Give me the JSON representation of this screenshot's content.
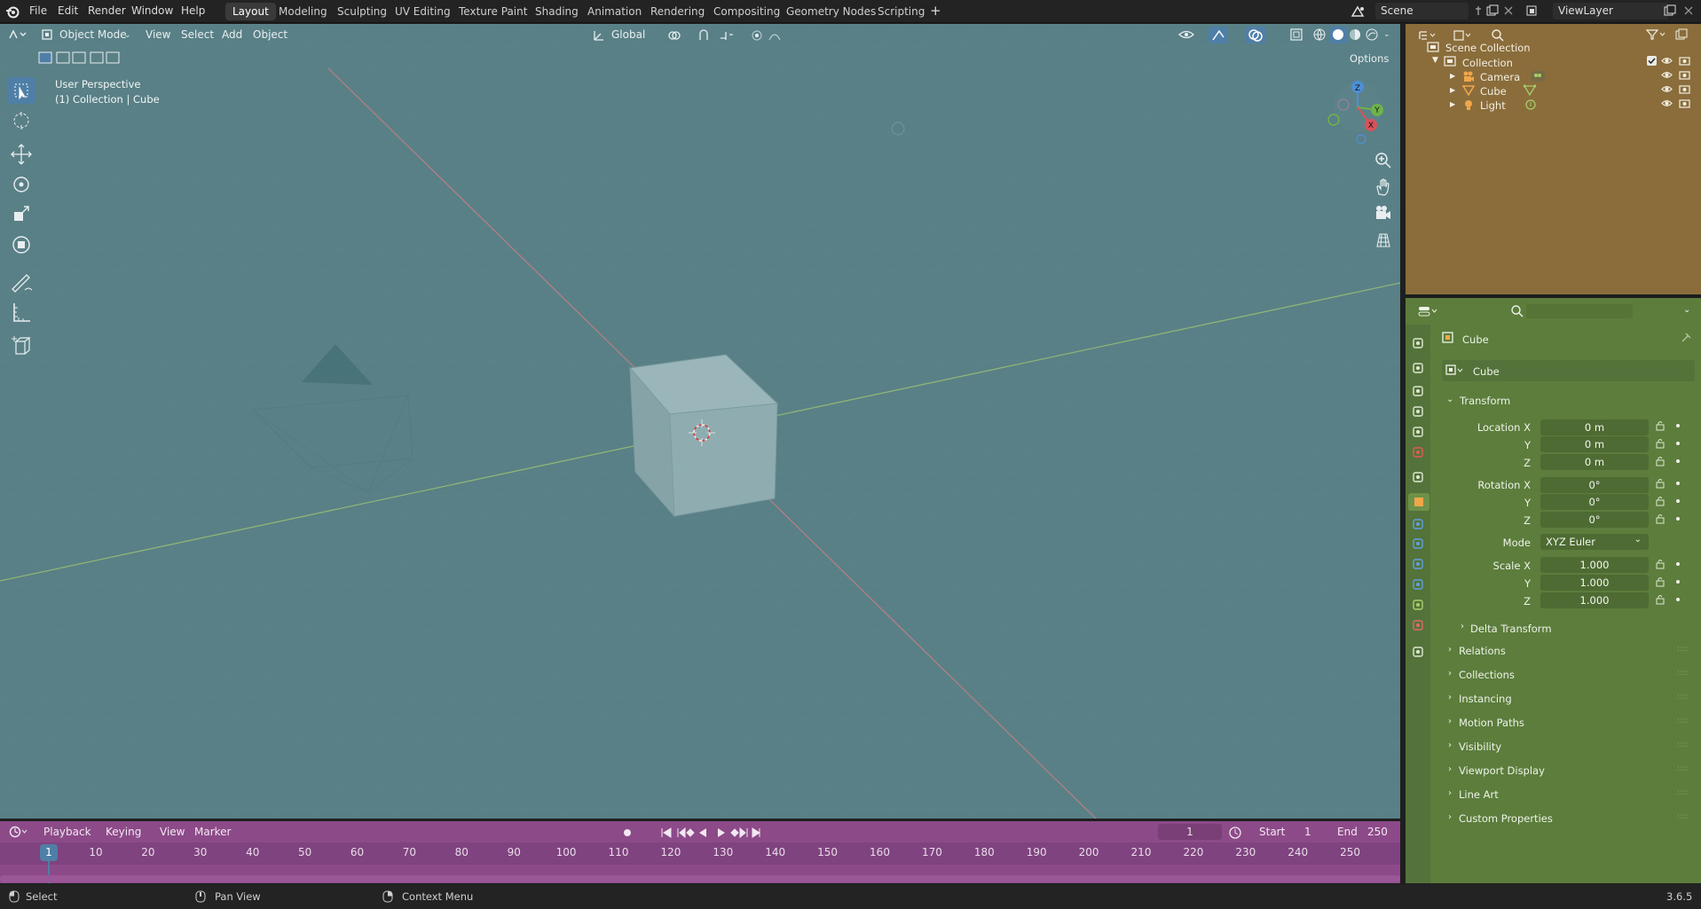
{
  "topbar": {
    "menus": [
      "File",
      "Edit",
      "Render",
      "Window",
      "Help"
    ],
    "workspaces": [
      "Layout",
      "Modeling",
      "Sculpting",
      "UV Editing",
      "Texture Paint",
      "Shading",
      "Animation",
      "Rendering",
      "Compositing",
      "Geometry Nodes",
      "Scripting"
    ],
    "active_workspace": "Layout",
    "add_workspace": "+",
    "scene": "Scene",
    "view_layer": "ViewLayer"
  },
  "viewport": {
    "mode": "Object Mode",
    "menus": [
      "View",
      "Select",
      "Add",
      "Object"
    ],
    "orientation": "Global",
    "options": "Options",
    "perspective": "User Perspective",
    "context": "(1) Collection | Cube",
    "gizmo": {
      "x": "X",
      "y": "Y",
      "z": "Z"
    },
    "background": "#598086"
  },
  "timeline": {
    "menus": [
      "Playback",
      "Keying",
      "View",
      "Marker"
    ],
    "current_frame": "1",
    "start_label": "Start",
    "start": "1",
    "end_label": "End",
    "end": "250",
    "ticks": [
      "10",
      "20",
      "30",
      "40",
      "50",
      "60",
      "70",
      "80",
      "90",
      "100",
      "110",
      "120",
      "130",
      "140",
      "150",
      "160",
      "170",
      "180",
      "190",
      "200",
      "210",
      "220",
      "230",
      "240",
      "250"
    ],
    "playhead": "1",
    "background": "#8c4a88"
  },
  "outliner": {
    "scene_collection": "Scene Collection",
    "collection": "Collection",
    "items": [
      "Camera",
      "Cube",
      "Light"
    ],
    "background": "#8a6d3b"
  },
  "properties": {
    "object_name": "Cube",
    "data_name": "Cube",
    "transform": "Transform",
    "location_label": "Location X",
    "location": [
      "0 m",
      "0 m",
      "0 m"
    ],
    "rotation_label": "Rotation X",
    "rotation": [
      "0°",
      "0°",
      "0°"
    ],
    "mode_label": "Mode",
    "mode": "XYZ Euler",
    "scale_label": "Scale X",
    "scale": [
      "1.000",
      "1.000",
      "1.000"
    ],
    "axis_y": "Y",
    "axis_z": "Z",
    "delta_transform": "Delta Transform",
    "panels": [
      "Relations",
      "Collections",
      "Instancing",
      "Motion Paths",
      "Visibility",
      "Viewport Display",
      "Line Art",
      "Custom Properties"
    ],
    "background": "#5c7d3c"
  },
  "statusbar": {
    "select": "Select",
    "pan_view": "Pan View",
    "context_menu": "Context Menu",
    "version": "3.6.5"
  }
}
